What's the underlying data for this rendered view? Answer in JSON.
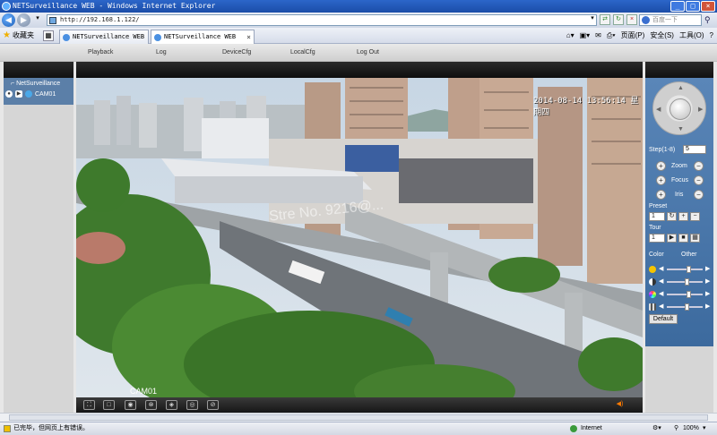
{
  "browser": {
    "title": "NETSurveillance WEB - Windows Internet Explorer",
    "url": "http://192.168.1.122/",
    "search_placeholder": "百度一下",
    "favorites": "收藏夹",
    "tabs": [
      {
        "label": "NETSurveillance WEB"
      },
      {
        "label": "NETSurveillance WEB"
      }
    ],
    "commands": [
      "页面(P)",
      "安全(S)",
      "工具(O)"
    ],
    "status_text": "已完毕，但网页上有错误。",
    "zone": "Internet",
    "zoom": "100%"
  },
  "app": {
    "menu": [
      "Playback",
      "Log",
      "DeviceCfg",
      "LocalCfg",
      "Log Out"
    ],
    "tree_root": "NetSurveillance",
    "camera": "CAM01"
  },
  "video": {
    "osd_time": "2014-08-14 13:56:14 星期四",
    "camera_label": "CAM01",
    "watermark": "Stre No. 9216@..."
  },
  "ptz": {
    "step_label": "Step(1-8)",
    "step_value": "5",
    "zoom": "Zoom",
    "focus": "Focus",
    "iris": "Iris",
    "preset": "Preset",
    "preset_value": "1",
    "tour": "Tour",
    "tour_value": "1",
    "color_tab": "Color",
    "other_tab": "Other",
    "default_button": "Default",
    "sliders": [
      {
        "name": "brightness",
        "color": "#f5c400",
        "level": 0.6
      },
      {
        "name": "contrast",
        "color": "#ffffff",
        "level": 0.55
      },
      {
        "name": "saturation",
        "color": "#e060c0",
        "level": 0.6
      },
      {
        "name": "hue",
        "color": "#dddddd",
        "level": 0.55
      }
    ]
  }
}
